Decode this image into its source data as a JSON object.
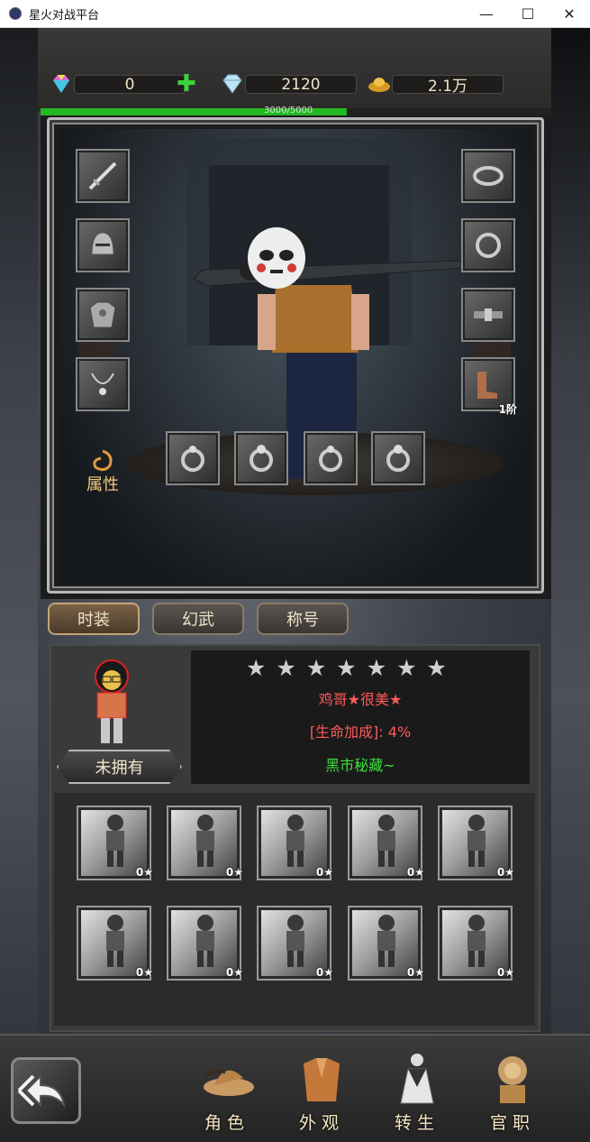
{
  "window": {
    "title": "星火对战平台",
    "minimize": "—",
    "maximize": "☐",
    "close": "✕"
  },
  "resources": {
    "gem_purple": "0",
    "diamond": "2120",
    "gold": "2.1万",
    "add_symbol": "✚"
  },
  "experience": {
    "text": "3000/5000",
    "fill": 0.6
  },
  "equipment": {
    "left_slots": [
      "sword-icon",
      "helmet-icon",
      "armor-icon",
      "necklace-icon"
    ],
    "right_slots": [
      "bracelet-icon",
      "ring-icon",
      "belt-icon",
      "boots-icon"
    ],
    "bottom_slots": [
      "ring-icon",
      "ring-icon",
      "ring-icon",
      "ring-icon"
    ],
    "boots_tier": "1阶",
    "attr_label": "属性"
  },
  "tabs": [
    {
      "label": "时装",
      "active": true
    },
    {
      "label": "幻武",
      "active": false
    },
    {
      "label": "称号",
      "active": false
    }
  ],
  "skin": {
    "stars_total": 7,
    "star_char": "★",
    "name": "鸡哥★很美★",
    "bonus": "[生命加成]:    4%",
    "source": "黑市秘藏~",
    "owned_button": "未拥有"
  },
  "collection": [
    {
      "stars": "0★"
    },
    {
      "stars": "0★"
    },
    {
      "stars": "0★"
    },
    {
      "stars": "0★"
    },
    {
      "stars": "0★"
    },
    {
      "stars": "0★"
    },
    {
      "stars": "0★"
    },
    {
      "stars": "0★"
    },
    {
      "stars": "0★"
    },
    {
      "stars": "0★"
    }
  ],
  "nav": [
    {
      "label": "角色",
      "icon": "hat-icon"
    },
    {
      "label": "外观",
      "icon": "robe-icon"
    },
    {
      "label": "转生",
      "icon": "monk-icon"
    },
    {
      "label": "官职",
      "icon": "lion-icon"
    }
  ],
  "colors": {
    "exp_green": "#23b923",
    "name_red": "#ff5a5a",
    "source_green": "#3ee23e"
  }
}
